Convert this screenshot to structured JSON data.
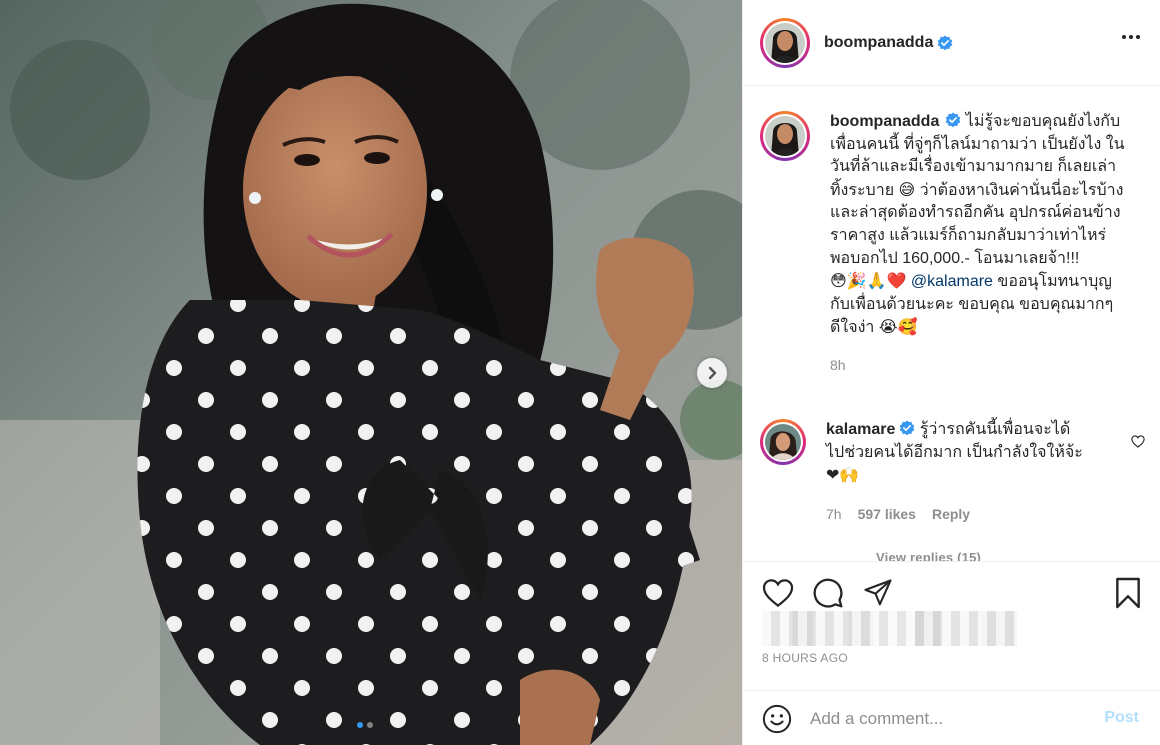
{
  "post": {
    "username": "boompanadda",
    "verified": true,
    "carousel": {
      "slide_count": 2,
      "active_index": 0
    }
  },
  "caption": {
    "username": "boompanadda",
    "text_part1": "ไม่รู้จะขอบคุณยังไงกับเพื่อนคนนี้ ที่จู่ๆก็ไลน์มาถามว่า เป็นยังไง ในวันที่ล้าและมีเรื่องเข้ามามากมาย ก็เลยเล่าทิ้งระบาย",
    "emoji1": "😅",
    "text_part2": " ว่าต้องหาเงินค่านั่นนี่อะไรบ้าง และล่าสุดต้องทำรถอีกคัน อุปกรณ์ค่อนข้างราคาสูง แล้วแมร์ก็ถามกลับมาว่าเท่าไหร่ พอบอกไป 160,000.- โอนมาเลยจ้า!!! ",
    "emoji2": "😳🎉🙏❤️",
    "mention": "@kalamare",
    "text_part3": " ขออนุโมทนาบุญกับเพื่อนด้วยนะคะ ขอบคุณ ขอบคุณมากๆ ดีใจง่า",
    "emoji3": "😭🥰",
    "time": "8h"
  },
  "comment": {
    "username": "kalamare",
    "verified": true,
    "text": " รู้ว่ารถคันนี้เพื่อนจะได้ไปช่วยคนได้อีกมาก เป็นกำลังใจให้จ้ะ",
    "emoji": "❤🙌",
    "time": "7h",
    "likes": "597 likes",
    "reply_label": "Reply",
    "view_replies": "View replies (15)"
  },
  "actions": {
    "timestamp": "8 HOURS AGO",
    "comment_placeholder": "Add a comment...",
    "post_label": "Post"
  },
  "icons": {
    "like": "heart-icon",
    "comment": "comment-bubble-icon",
    "share": "paper-plane-icon",
    "save": "bookmark-icon",
    "emoji": "smiley-icon",
    "more": "more-options-icon",
    "next": "chevron-right-icon"
  },
  "colors": {
    "verified_blue": "#3897f0",
    "link_blue": "#00376b",
    "post_disabled": "#b2dffc",
    "gray_text": "#8e8e8e"
  }
}
